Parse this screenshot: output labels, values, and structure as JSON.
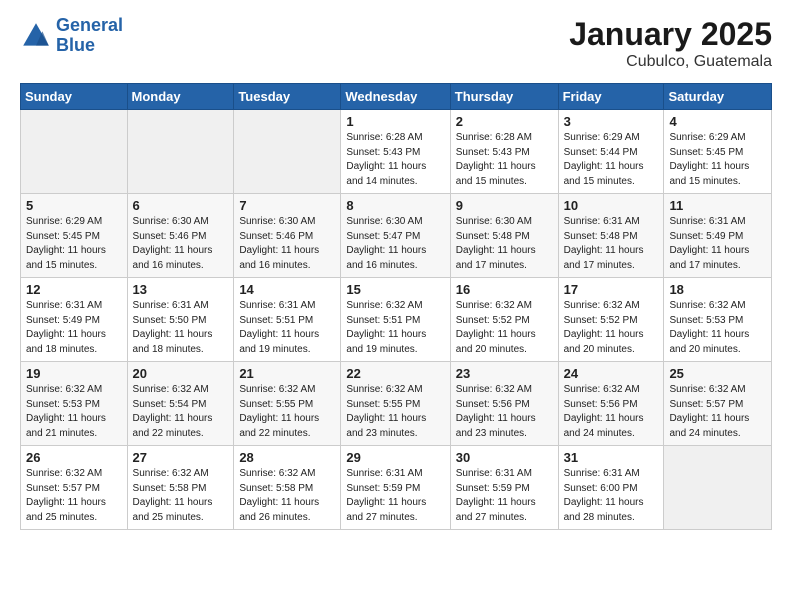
{
  "header": {
    "logo_line1": "General",
    "logo_line2": "Blue",
    "month": "January 2025",
    "location": "Cubulco, Guatemala"
  },
  "weekdays": [
    "Sunday",
    "Monday",
    "Tuesday",
    "Wednesday",
    "Thursday",
    "Friday",
    "Saturday"
  ],
  "weeks": [
    [
      {
        "day": "",
        "info": ""
      },
      {
        "day": "",
        "info": ""
      },
      {
        "day": "",
        "info": ""
      },
      {
        "day": "1",
        "info": "Sunrise: 6:28 AM\nSunset: 5:43 PM\nDaylight: 11 hours\nand 14 minutes."
      },
      {
        "day": "2",
        "info": "Sunrise: 6:28 AM\nSunset: 5:43 PM\nDaylight: 11 hours\nand 15 minutes."
      },
      {
        "day": "3",
        "info": "Sunrise: 6:29 AM\nSunset: 5:44 PM\nDaylight: 11 hours\nand 15 minutes."
      },
      {
        "day": "4",
        "info": "Sunrise: 6:29 AM\nSunset: 5:45 PM\nDaylight: 11 hours\nand 15 minutes."
      }
    ],
    [
      {
        "day": "5",
        "info": "Sunrise: 6:29 AM\nSunset: 5:45 PM\nDaylight: 11 hours\nand 15 minutes."
      },
      {
        "day": "6",
        "info": "Sunrise: 6:30 AM\nSunset: 5:46 PM\nDaylight: 11 hours\nand 16 minutes."
      },
      {
        "day": "7",
        "info": "Sunrise: 6:30 AM\nSunset: 5:46 PM\nDaylight: 11 hours\nand 16 minutes."
      },
      {
        "day": "8",
        "info": "Sunrise: 6:30 AM\nSunset: 5:47 PM\nDaylight: 11 hours\nand 16 minutes."
      },
      {
        "day": "9",
        "info": "Sunrise: 6:30 AM\nSunset: 5:48 PM\nDaylight: 11 hours\nand 17 minutes."
      },
      {
        "day": "10",
        "info": "Sunrise: 6:31 AM\nSunset: 5:48 PM\nDaylight: 11 hours\nand 17 minutes."
      },
      {
        "day": "11",
        "info": "Sunrise: 6:31 AM\nSunset: 5:49 PM\nDaylight: 11 hours\nand 17 minutes."
      }
    ],
    [
      {
        "day": "12",
        "info": "Sunrise: 6:31 AM\nSunset: 5:49 PM\nDaylight: 11 hours\nand 18 minutes."
      },
      {
        "day": "13",
        "info": "Sunrise: 6:31 AM\nSunset: 5:50 PM\nDaylight: 11 hours\nand 18 minutes."
      },
      {
        "day": "14",
        "info": "Sunrise: 6:31 AM\nSunset: 5:51 PM\nDaylight: 11 hours\nand 19 minutes."
      },
      {
        "day": "15",
        "info": "Sunrise: 6:32 AM\nSunset: 5:51 PM\nDaylight: 11 hours\nand 19 minutes."
      },
      {
        "day": "16",
        "info": "Sunrise: 6:32 AM\nSunset: 5:52 PM\nDaylight: 11 hours\nand 20 minutes."
      },
      {
        "day": "17",
        "info": "Sunrise: 6:32 AM\nSunset: 5:52 PM\nDaylight: 11 hours\nand 20 minutes."
      },
      {
        "day": "18",
        "info": "Sunrise: 6:32 AM\nSunset: 5:53 PM\nDaylight: 11 hours\nand 20 minutes."
      }
    ],
    [
      {
        "day": "19",
        "info": "Sunrise: 6:32 AM\nSunset: 5:53 PM\nDaylight: 11 hours\nand 21 minutes."
      },
      {
        "day": "20",
        "info": "Sunrise: 6:32 AM\nSunset: 5:54 PM\nDaylight: 11 hours\nand 22 minutes."
      },
      {
        "day": "21",
        "info": "Sunrise: 6:32 AM\nSunset: 5:55 PM\nDaylight: 11 hours\nand 22 minutes."
      },
      {
        "day": "22",
        "info": "Sunrise: 6:32 AM\nSunset: 5:55 PM\nDaylight: 11 hours\nand 23 minutes."
      },
      {
        "day": "23",
        "info": "Sunrise: 6:32 AM\nSunset: 5:56 PM\nDaylight: 11 hours\nand 23 minutes."
      },
      {
        "day": "24",
        "info": "Sunrise: 6:32 AM\nSunset: 5:56 PM\nDaylight: 11 hours\nand 24 minutes."
      },
      {
        "day": "25",
        "info": "Sunrise: 6:32 AM\nSunset: 5:57 PM\nDaylight: 11 hours\nand 24 minutes."
      }
    ],
    [
      {
        "day": "26",
        "info": "Sunrise: 6:32 AM\nSunset: 5:57 PM\nDaylight: 11 hours\nand 25 minutes."
      },
      {
        "day": "27",
        "info": "Sunrise: 6:32 AM\nSunset: 5:58 PM\nDaylight: 11 hours\nand 25 minutes."
      },
      {
        "day": "28",
        "info": "Sunrise: 6:32 AM\nSunset: 5:58 PM\nDaylight: 11 hours\nand 26 minutes."
      },
      {
        "day": "29",
        "info": "Sunrise: 6:31 AM\nSunset: 5:59 PM\nDaylight: 11 hours\nand 27 minutes."
      },
      {
        "day": "30",
        "info": "Sunrise: 6:31 AM\nSunset: 5:59 PM\nDaylight: 11 hours\nand 27 minutes."
      },
      {
        "day": "31",
        "info": "Sunrise: 6:31 AM\nSunset: 6:00 PM\nDaylight: 11 hours\nand 28 minutes."
      },
      {
        "day": "",
        "info": ""
      }
    ]
  ]
}
